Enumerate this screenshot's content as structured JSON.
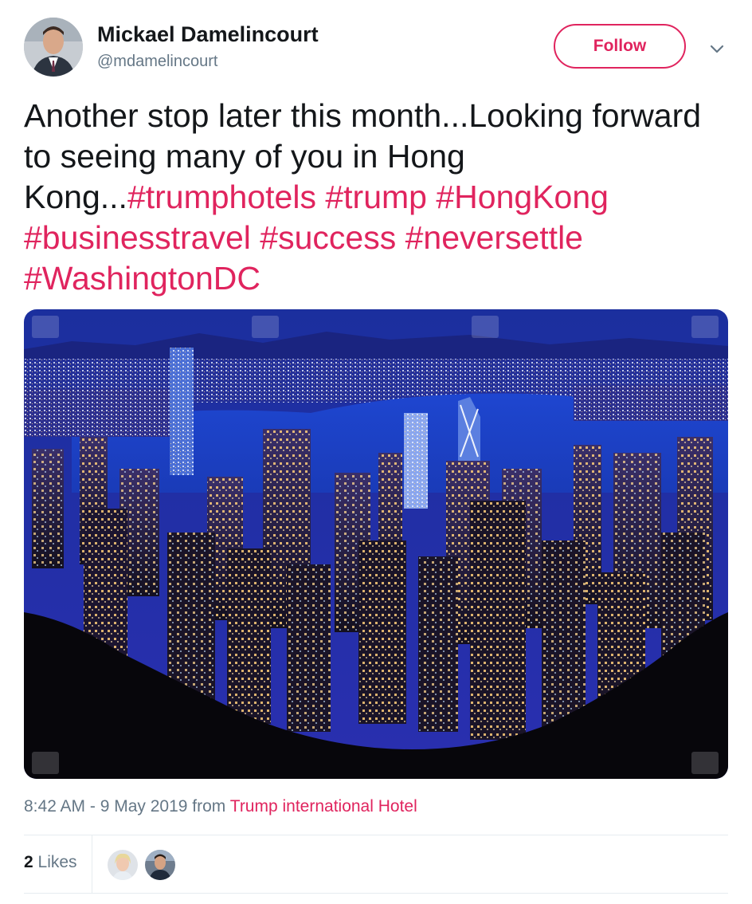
{
  "user": {
    "display_name": "Mickael Damelincourt",
    "handle": "@mdamelincourt"
  },
  "actions": {
    "follow_label": "Follow",
    "more_icon": "chevron-down-icon"
  },
  "tweet": {
    "text_plain": "Another stop later this month...Looking forward to seeing many of you in Hong Kong...",
    "hashtags": [
      "#trumphotels",
      "#trump",
      "#HongKong",
      "#businesstravel",
      "#success",
      "#neversettle",
      "#WashingtonDC"
    ],
    "timestamp": "8:42 AM - 9 May 2019",
    "from_label": "from",
    "source": "Trump international Hotel"
  },
  "engagement": {
    "likes_count": "2",
    "likes_label": "Likes"
  },
  "colors": {
    "accent": "#e0245e",
    "secondary_text": "#657786",
    "primary_text": "#14171a",
    "divider": "#e6ecf0"
  }
}
